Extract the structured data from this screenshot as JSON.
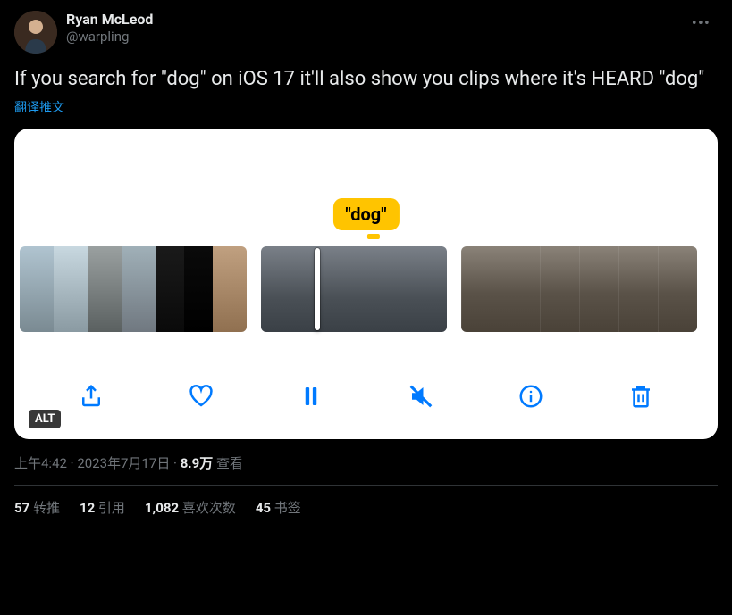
{
  "author": {
    "display_name": "Ryan McLeod",
    "handle": "@warpling"
  },
  "tweet_text": "If you search for \"dog\" on iOS 17 it'll also show you clips where it's HEARD \"dog\"",
  "translate_label": "翻译推文",
  "media": {
    "search_label": "\"dog\"",
    "alt_badge": "ALT",
    "toolbar": {
      "share": "share-icon",
      "heart": "heart-icon",
      "pause": "pause-icon",
      "mute": "mute-icon",
      "info": "info-icon",
      "trash": "trash-icon"
    }
  },
  "meta": {
    "time": "上午4:42",
    "date": "2023年7月17日",
    "views_count": "8.9万",
    "views_label": "查看"
  },
  "stats": {
    "retweets": {
      "count": "57",
      "label": "转推"
    },
    "quotes": {
      "count": "12",
      "label": "引用"
    },
    "likes": {
      "count": "1,082",
      "label": "喜欢次数"
    },
    "bookmarks": {
      "count": "45",
      "label": "书签"
    }
  }
}
